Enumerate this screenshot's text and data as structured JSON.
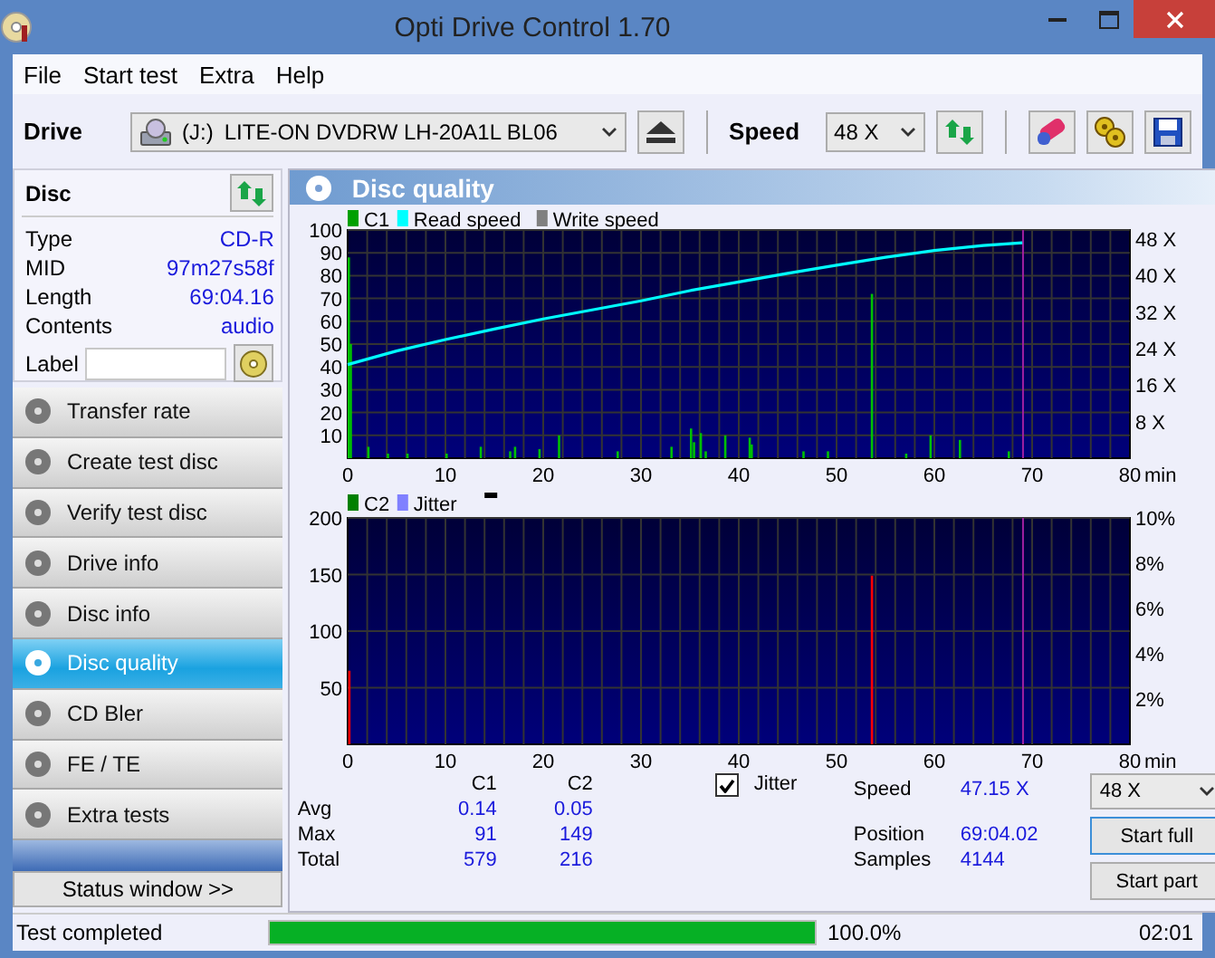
{
  "window": {
    "title": "Opti Drive Control 1.70"
  },
  "menu": [
    "File",
    "Start test",
    "Extra",
    "Help"
  ],
  "toolbar": {
    "drive_label": "Drive",
    "drive_letter": "(J:)",
    "drive_name": "LITE-ON DVDRW LH-20A1L BL06",
    "speed_label": "Speed",
    "speed_value": "48 X"
  },
  "disc": {
    "title": "Disc",
    "fields": [
      {
        "label": "Type",
        "value": "CD-R"
      },
      {
        "label": "MID",
        "value": "97m27s58f"
      },
      {
        "label": "Length",
        "value": "69:04.16"
      },
      {
        "label": "Contents",
        "value": "audio"
      }
    ],
    "label_field": {
      "label": "Label"
    }
  },
  "nav": [
    {
      "label": "Transfer rate",
      "selected": false
    },
    {
      "label": "Create test disc",
      "selected": false
    },
    {
      "label": "Verify test disc",
      "selected": false
    },
    {
      "label": "Drive info",
      "selected": false
    },
    {
      "label": "Disc info",
      "selected": false
    },
    {
      "label": "Disc quality",
      "selected": true
    },
    {
      "label": "CD Bler",
      "selected": false
    },
    {
      "label": "FE / TE",
      "selected": false
    },
    {
      "label": "Extra tests",
      "selected": false
    }
  ],
  "status_window_button": "Status window >>",
  "panel": {
    "title": "Disc quality",
    "charts": [
      {
        "legend": [
          {
            "color": "#00a000"
          },
          {
            "color": "#00ffff"
          },
          {
            "name": "Write speed",
            "color": "#808080"
          }
        ],
        "chart_data": {
          "type": "bar",
          "grid": true,
          "xlabel": "min",
          "xlim": [
            0,
            80
          ],
          "ylim": [
            0,
            100
          ],
          "y2lim": [
            0,
            50
          ],
          "xticks": [
            0,
            10,
            20,
            30,
            40,
            50,
            60,
            70,
            80
          ],
          "yticks": [
            10,
            20,
            30,
            40,
            50,
            60,
            70,
            80,
            90,
            100
          ],
          "y2ticks": [
            {
              "value": 8,
              "label": "8 X"
            },
            {
              "value": 16,
              "label": "16 X"
            },
            {
              "value": 24,
              "label": "24 X"
            },
            {
              "value": 32,
              "label": "32 X"
            },
            {
              "value": 40,
              "label": "40 X"
            },
            {
              "value": 48,
              "label": "48 X"
            }
          ],
          "ref_lines": [
            {
              "axis": "x",
              "value": 69.07,
              "color": "#a020a0"
            }
          ],
          "series": [
            {
              "name": "C1",
              "color": "#00c000",
              "x": [
                0,
                0.2,
                2,
                4,
                6,
                10,
                13.5,
                16.5,
                17,
                19.5,
                21.5,
                27.5,
                33,
                35,
                35.3,
                36,
                36.5,
                38.5,
                41,
                41.2,
                46.5,
                49,
                53.5,
                57,
                59.5,
                62.5,
                67.5
              ],
              "values": [
                88,
                50,
                5,
                2,
                2,
                2,
                5,
                3,
                5,
                4,
                10,
                3,
                5,
                13,
                7,
                11,
                3,
                10,
                9,
                6,
                3,
                3,
                72,
                2,
                10,
                8,
                3
              ]
            },
            {
              "name": "Read speed",
              "type": "line",
              "color": "#00ffff",
              "x": [
                0,
                5,
                10,
                15,
                20,
                25,
                30,
                35,
                40,
                45,
                50,
                55,
                60,
                65,
                69
              ],
              "values": [
                41,
                47,
                52,
                56.6,
                61,
                65,
                69,
                73.4,
                77.2,
                81,
                84.6,
                88,
                91,
                93.2,
                94.4
              ]
            }
          ]
        }
      },
      {
        "legend": [
          {
            "color": "#008000"
          },
          {
            "name": "Jitter",
            "color": "#8080ff"
          }
        ],
        "chart_data": {
          "type": "bar",
          "grid": true,
          "xlabel": "min",
          "xlim": [
            0,
            80
          ],
          "ylim": [
            0,
            200
          ],
          "y2lim": [
            0,
            10
          ],
          "xticks": [
            0,
            10,
            20,
            30,
            40,
            50,
            60,
            70,
            80
          ],
          "yticks": [
            50,
            100,
            150,
            200
          ],
          "y2ticks": [
            {
              "value": 2,
              "label": "2%"
            },
            {
              "value": 4,
              "label": "4%"
            },
            {
              "value": 6,
              "label": "6%"
            },
            {
              "value": 8,
              "label": "8%"
            },
            {
              "value": 10,
              "label": "10%"
            }
          ],
          "ref_lines": [
            {
              "axis": "x",
              "value": 69.07,
              "color": "#a020a0"
            }
          ],
          "series": [
            {
              "name": "C2",
              "color": "#ff0000",
              "x": [
                0.05,
                53.5
              ],
              "values": [
                65,
                149
              ]
            }
          ]
        }
      }
    ],
    "stats": {
      "columns": [
        "C1",
        "C2"
      ],
      "rows": [
        {
          "label": "Avg",
          "values": [
            "0.14",
            "0.05"
          ]
        },
        {
          "label": "Max",
          "values": [
            "91",
            "149"
          ]
        },
        {
          "label": "Total",
          "values": [
            "579",
            "216"
          ]
        }
      ]
    },
    "jitter": {
      "label": "Jitter",
      "checked": true
    },
    "info": [
      {
        "label": "Speed",
        "value": "47.15 X"
      },
      {
        "label": "Position",
        "value": "69:04.02"
      },
      {
        "label": "Samples",
        "value": "4144"
      }
    ],
    "speed_select": "48 X",
    "buttons": [
      "Start full",
      "Start part"
    ]
  },
  "status_bar": {
    "message": "Test completed",
    "level": 1,
    "percent": "100.0%",
    "time": "02:01"
  }
}
